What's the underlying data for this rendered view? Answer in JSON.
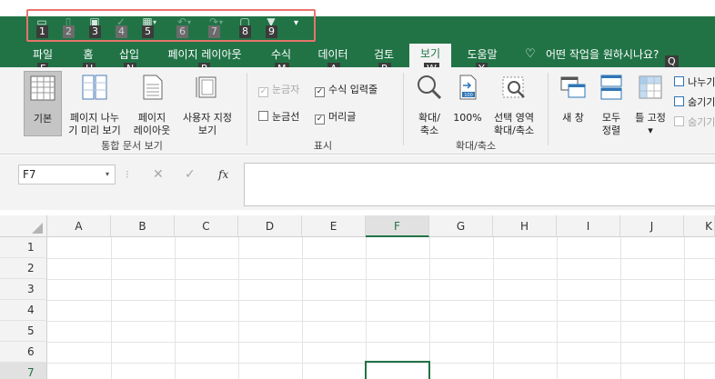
{
  "qat": {
    "items": [
      {
        "icon": "save-icon",
        "keytip": "1",
        "dim": false
      },
      {
        "icon": "touch-mode-icon",
        "keytip": "2",
        "dim": true
      },
      {
        "icon": "print-preview-icon",
        "keytip": "3",
        "dim": false
      },
      {
        "icon": "spelling-icon",
        "keytip": "4",
        "dim": true
      },
      {
        "icon": "table-format-icon",
        "keytip": "5",
        "dim": false
      },
      {
        "icon": "undo-icon",
        "keytip": "6",
        "dim": true
      },
      {
        "icon": "redo-icon",
        "keytip": "7",
        "dim": true
      },
      {
        "icon": "device-icon",
        "keytip": "8",
        "dim": false
      },
      {
        "icon": "filter-icon",
        "keytip": "9",
        "dim": false
      }
    ],
    "more": "▾"
  },
  "tabs": [
    {
      "label": "파일",
      "keytip": "F"
    },
    {
      "label": "홈",
      "keytip": "H"
    },
    {
      "label": "삽입",
      "keytip": "N"
    },
    {
      "label": "페이지 레이아웃",
      "keytip": "P"
    },
    {
      "label": "수식",
      "keytip": "M"
    },
    {
      "label": "데이터",
      "keytip": "A"
    },
    {
      "label": "검토",
      "keytip": "R"
    },
    {
      "label": "보기",
      "keytip": "W",
      "active": true
    },
    {
      "label": "도움말",
      "keytip": "Y"
    },
    {
      "label": "어떤 작업을 원하시나요?",
      "keytip": "Q"
    }
  ],
  "ribbon": {
    "workbook_views": {
      "group_label": "통합 문서 보기",
      "normal": "기본",
      "page_break_line1": "페이지 나누",
      "page_break_line2": "기 미리 보기",
      "page_layout_line1": "페이지",
      "page_layout_line2": "레이아웃",
      "custom_line1": "사용자 지정",
      "custom_line2": "보기"
    },
    "show": {
      "group_label": "표시",
      "ruler": "눈금자",
      "formula_bar": "수식 입력줄",
      "gridlines": "눈금선",
      "headings": "머리글"
    },
    "zoom": {
      "group_label": "확대/축소",
      "zoom_line1": "확대/",
      "zoom_line2": "축소",
      "hundred": "100%",
      "selection_line1": "선택 영역",
      "selection_line2": "확대/축소",
      "hundred_icon_text": "100"
    },
    "window": {
      "new_window": "새 창",
      "arrange_line1": "모두",
      "arrange_line2": "정렬",
      "freeze": "틀 고정",
      "freeze_arrow": "▾",
      "split": "나누기",
      "hide": "숨기기",
      "unhide": "숨기기 취소"
    }
  },
  "formula_bar": {
    "name_box": "F7",
    "name_box_arrow": "▾",
    "separator": "⁝",
    "cancel": "✕",
    "enter": "✓",
    "fx": "fx"
  },
  "grid": {
    "columns": [
      "A",
      "B",
      "C",
      "D",
      "E",
      "F",
      "G",
      "H",
      "I",
      "J",
      "K"
    ],
    "rows": [
      "1",
      "2",
      "3",
      "4",
      "5",
      "6",
      "7"
    ],
    "selected_column": "F",
    "selected_row": "7"
  }
}
